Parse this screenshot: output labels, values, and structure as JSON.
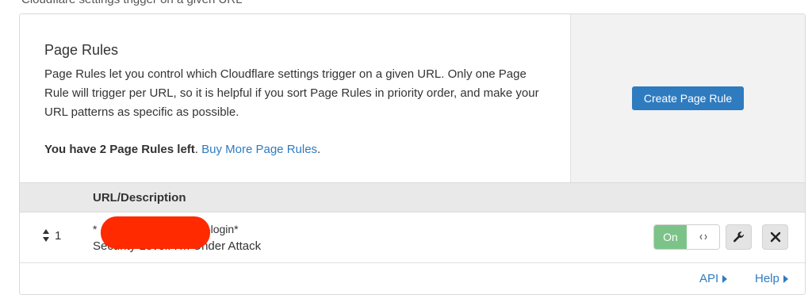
{
  "top_cutoff_text": "Cloudflare settings trigger on a given URL",
  "intro": {
    "title": "Page Rules",
    "description": "Page Rules let you control which Cloudflare settings trigger on a given URL. Only one Page Rule will trigger per URL, so it is helpful if you sort Page Rules in priority order, and make your URL patterns as specific as possible.",
    "quota_text": "You have 2 Page Rules left",
    "quota_suffix": ".",
    "buy_more_link": "Buy More Page Rules",
    "buy_more_suffix": "."
  },
  "actions": {
    "create_button": "Create Page Rule"
  },
  "table": {
    "header_column": "URL/Description",
    "rows": [
      {
        "priority": "1",
        "url_prefix": "*",
        "url_suffix": "/wp-login*",
        "setting": "Security Level: I'm Under Attack",
        "toggle_label": "On",
        "enabled": true
      }
    ]
  },
  "icons": {
    "sort": "sort-icon",
    "toggle_handle": "chevron-left-right-icon",
    "edit": "wrench-icon",
    "delete": "close-icon",
    "caret": "caret-right-icon"
  },
  "footer": {
    "api_link": "API",
    "help_link": "Help"
  },
  "colors": {
    "accent": "#2f7bbf",
    "toggle_on": "#7cc389",
    "redaction": "#ff2a00",
    "header_bg": "#e9e9e9",
    "side_panel_bg": "#f2f2f2"
  }
}
